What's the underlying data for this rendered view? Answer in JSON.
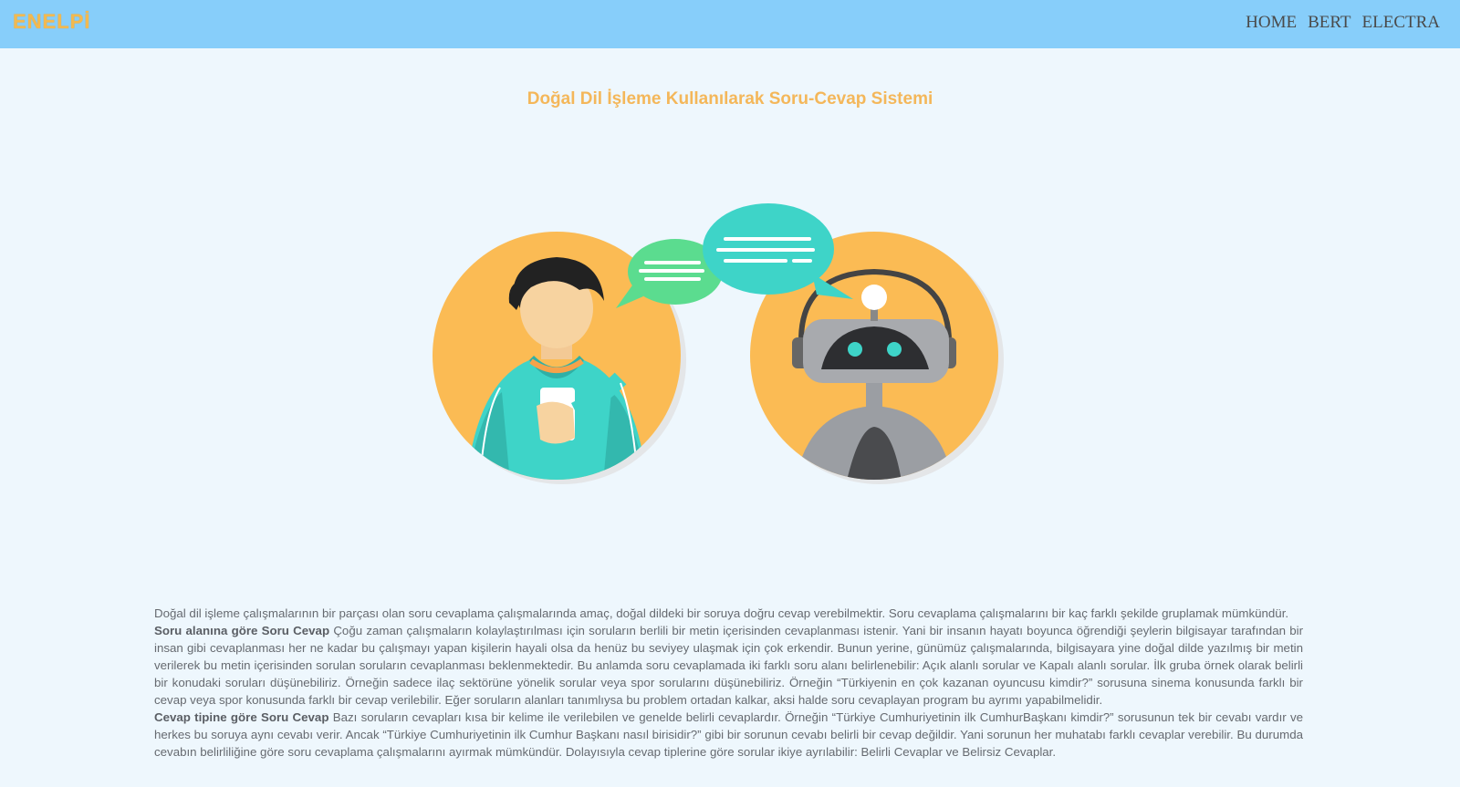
{
  "navbar": {
    "brand": "ENELPİ",
    "links": [
      "HOME",
      "BERT",
      "ELECTRA"
    ]
  },
  "page": {
    "title": "Doğal Dil İşleme Kullanılarak Soru-Cevap Sistemi"
  },
  "hero": {
    "image": "person-chatting-with-robot-illustration"
  },
  "content": {
    "intro": "Doğal dil işleme çalışmalarının bir parçası olan soru cevaplama çalışmalarında amaç, doğal dildeki bir soruya doğru cevap verebilmektir. Soru cevaplama çalışmalarını bir kaç farklı şekilde gruplamak mümkündür.",
    "section1_title": "Soru alanına göre Soru Cevap",
    "section1_text": " Çoğu zaman çalışmaların kolaylaştırılması için soruların berlili bir metin içerisinden cevaplanması istenir. Yani bir insanın hayatı boyunca öğrendiği şeylerin bilgisayar tarafından bir insan gibi cevaplanması her ne kadar bu çalışmayı yapan kişilerin hayali olsa da henüz bu seviyey ulaşmak için çok erkendir. Bunun yerine, günümüz çalışmalarında, bilgisayara yine doğal dilde yazılmış bir metin verilerek bu metin içerisinden sorulan soruların cevaplanması beklenmektedir. Bu anlamda soru cevaplamada iki farklı soru alanı belirlenebilir: Açık alanlı sorular ve Kapalı alanlı sorular. İlk gruba örnek olarak belirli bir konudaki soruları düşünebiliriz. Örneğin sadece ilaç sektörüne yönelik sorular veya spor sorularını düşünebiliriz. Örneğin “Türkiyenin en çok kazanan oyuncusu kimdir?” sorusuna sinema konusunda farklı bir cevap veya spor konusunda farklı bir cevap verilebilir. Eğer soruların alanları tanımlıysa bu problem ortadan kalkar, aksi halde soru cevaplayan program bu ayrımı yapabilmelidir.",
    "section2_title": "Cevap tipine göre Soru Cevap",
    "section2_text": " Bazı soruların cevapları kısa bir kelime ile verilebilen ve genelde belirli cevaplardır. Örneğin “Türkiye Cumhuriyetinin ilk CumhurBaşkanı kimdir?” sorusunun tek bir cevabı vardır ve herkes bu soruya aynı cevabı verir. Ancak “Türkiye Cumhuriyetinin ilk Cumhur Başkanı nasıl birisidir?” gibi bir sorunun cevabı belirli bir cevap değildir. Yani sorunun her muhatabı farklı cevaplar verebilir. Bu durumda cevabın belirliliğine göre soru cevaplama çalışmalarını ayırmak mümkündür. Dolayısıyla cevap tiplerine göre sorular ikiye ayrılabilir: Belirli Cevaplar ve Belirsiz Cevaplar."
  }
}
